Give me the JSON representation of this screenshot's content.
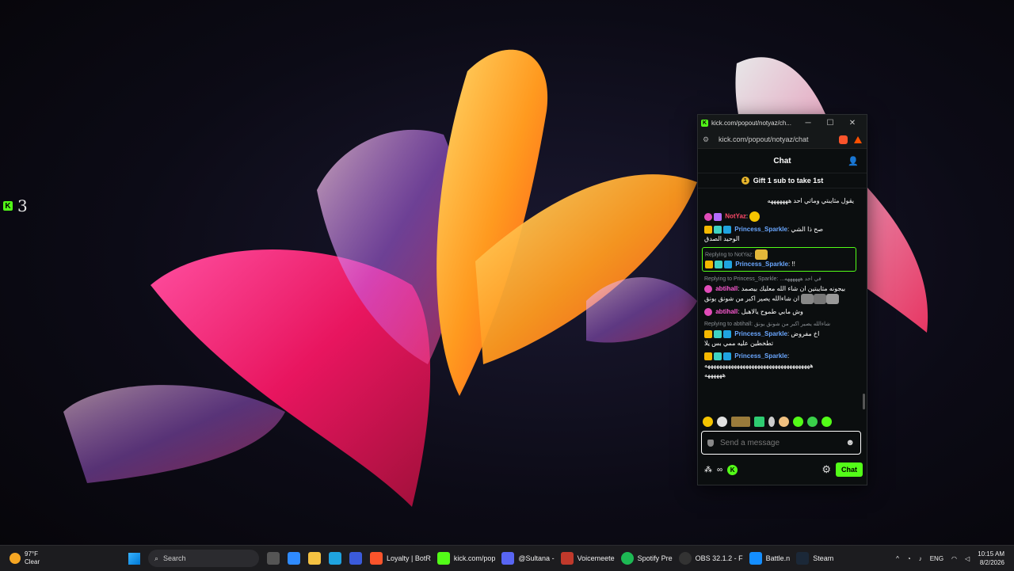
{
  "desktop": {
    "widget_count": "3"
  },
  "window": {
    "title": "kick.com/popout/notyaz/ch...",
    "url": "kick.com/popout/notyaz/chat",
    "minimize": "─",
    "maximize": "☐",
    "close": "✕"
  },
  "chat": {
    "header": "Chat",
    "pinned": "Gift 1 sub to take 1st",
    "messages": [
      {
        "text": "يقول مثايبتي وماتي احد هههههههه"
      },
      {
        "user": "NotYaz",
        "sep": ":"
      },
      {
        "user": "Princess_Sparkle",
        "sep": ":",
        "text": "صح ذا الشي",
        "text2": "الوحيد الصدق"
      },
      {
        "reply": "Replying to NotYaz:",
        "user": "Princess_Sparkle",
        "sep": ":",
        "text": "!!"
      },
      {
        "reply": "Replying to Princess_Sparkle: ...في احد ههههههه",
        "user": "abtihall",
        "sep": ":",
        "text": "بيجونه مثايبتين ان شاء الله معليك بيصمد",
        "text2": "ان شاءالله يصير اكبر من شونق يونق"
      },
      {
        "user": "abtihall",
        "sep": ":",
        "text": "وش مابي طموح يالاهبل"
      },
      {
        "reply": "Replying to abtihall: شاءالله يصير اكبر من شونق يونق",
        "user": "Princess_Sparkle",
        "sep": ":",
        "text": "اخ مفروض",
        "text2": "تطخطين عليه ممي بس يلا"
      },
      {
        "user": "Princess_Sparkle",
        "sep": ":",
        "text": "ههههههههههههههههههههههههههههههههههههه",
        "text2": "ههههههه"
      }
    ],
    "input_placeholder": "Send a message",
    "infinity": "∞",
    "send_label": "Chat"
  },
  "taskbar": {
    "weather_temp": "97°F",
    "weather_desc": "Clear",
    "search": "Search",
    "apps": [
      "Loyalty | BotR",
      "kick.com/pop",
      "@Sultana -",
      "Voicemeete",
      "Spotify Pre",
      "OBS 32.1.2 - F",
      "Battle.n",
      "Steam"
    ],
    "lang": "ENG",
    "time": "10:15 AM",
    "date": "8/2/2026"
  },
  "colors": {
    "kick_green": "#53fc18",
    "sparkle_blue": "#6aa7ff",
    "notyaz_red": "#ff4a6a",
    "abti_pink": "#ff5bd4"
  }
}
